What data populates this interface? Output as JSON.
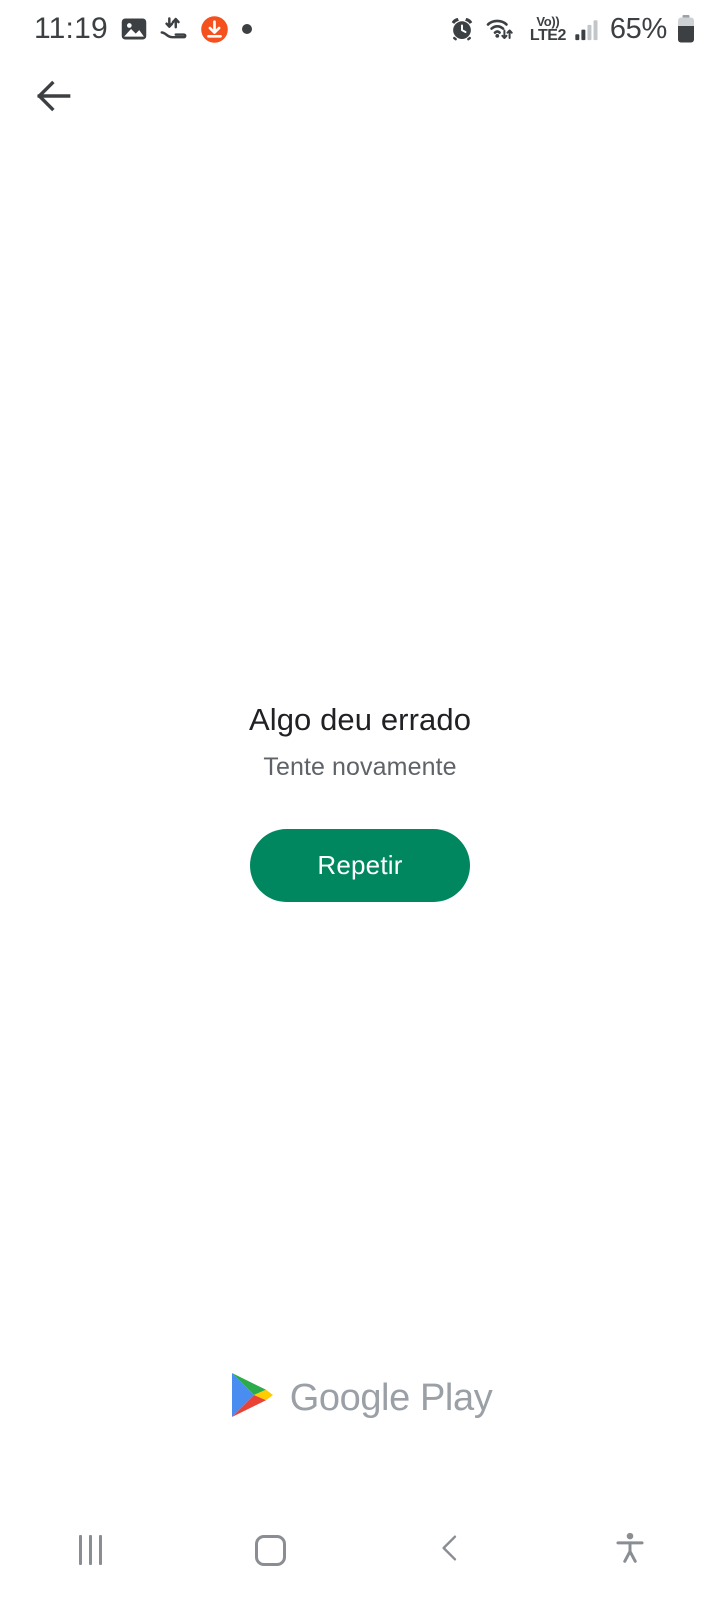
{
  "status_bar": {
    "time": "11:19",
    "battery_percent": "65%",
    "volte_label": "Vo))",
    "network_label": "LTE2",
    "left_icons": [
      {
        "name": "gallery-image-icon"
      },
      {
        "name": "data-transfer-icon"
      },
      {
        "name": "download-notification-icon"
      },
      {
        "name": "notification-dot-icon"
      }
    ],
    "right_icons": [
      {
        "name": "alarm-clock-icon"
      },
      {
        "name": "wifi-data-icon"
      },
      {
        "name": "signal-bars-icon"
      },
      {
        "name": "battery-icon"
      }
    ],
    "colors": {
      "text": "#3c4043",
      "download_badge": "#f4511e"
    }
  },
  "appbar": {
    "back_icon": "arrow-left-icon"
  },
  "main": {
    "title": "Algo deu errado",
    "subtitle": "Tente novamente",
    "retry_label": "Repetir",
    "accent_color": "#01875f",
    "title_color": "#202124",
    "subtitle_color": "#5f6368"
  },
  "footer": {
    "brand": "Google Play",
    "logo_icon": "google-play-triangle-icon",
    "brand_color": "#9aa0a6",
    "logo_colors": {
      "blue": "#34a4f0",
      "green": "#2bab4c",
      "yellow": "#ffcc00",
      "red": "#ea4335"
    }
  },
  "nav_bar": {
    "items": [
      {
        "name": "recents-button",
        "icon": "recents-icon"
      },
      {
        "name": "home-button",
        "icon": "home-icon"
      },
      {
        "name": "back-button",
        "icon": "chevron-left-icon"
      },
      {
        "name": "accessibility-button",
        "icon": "accessibility-person-icon"
      }
    ],
    "icon_color": "#8a8d91"
  }
}
